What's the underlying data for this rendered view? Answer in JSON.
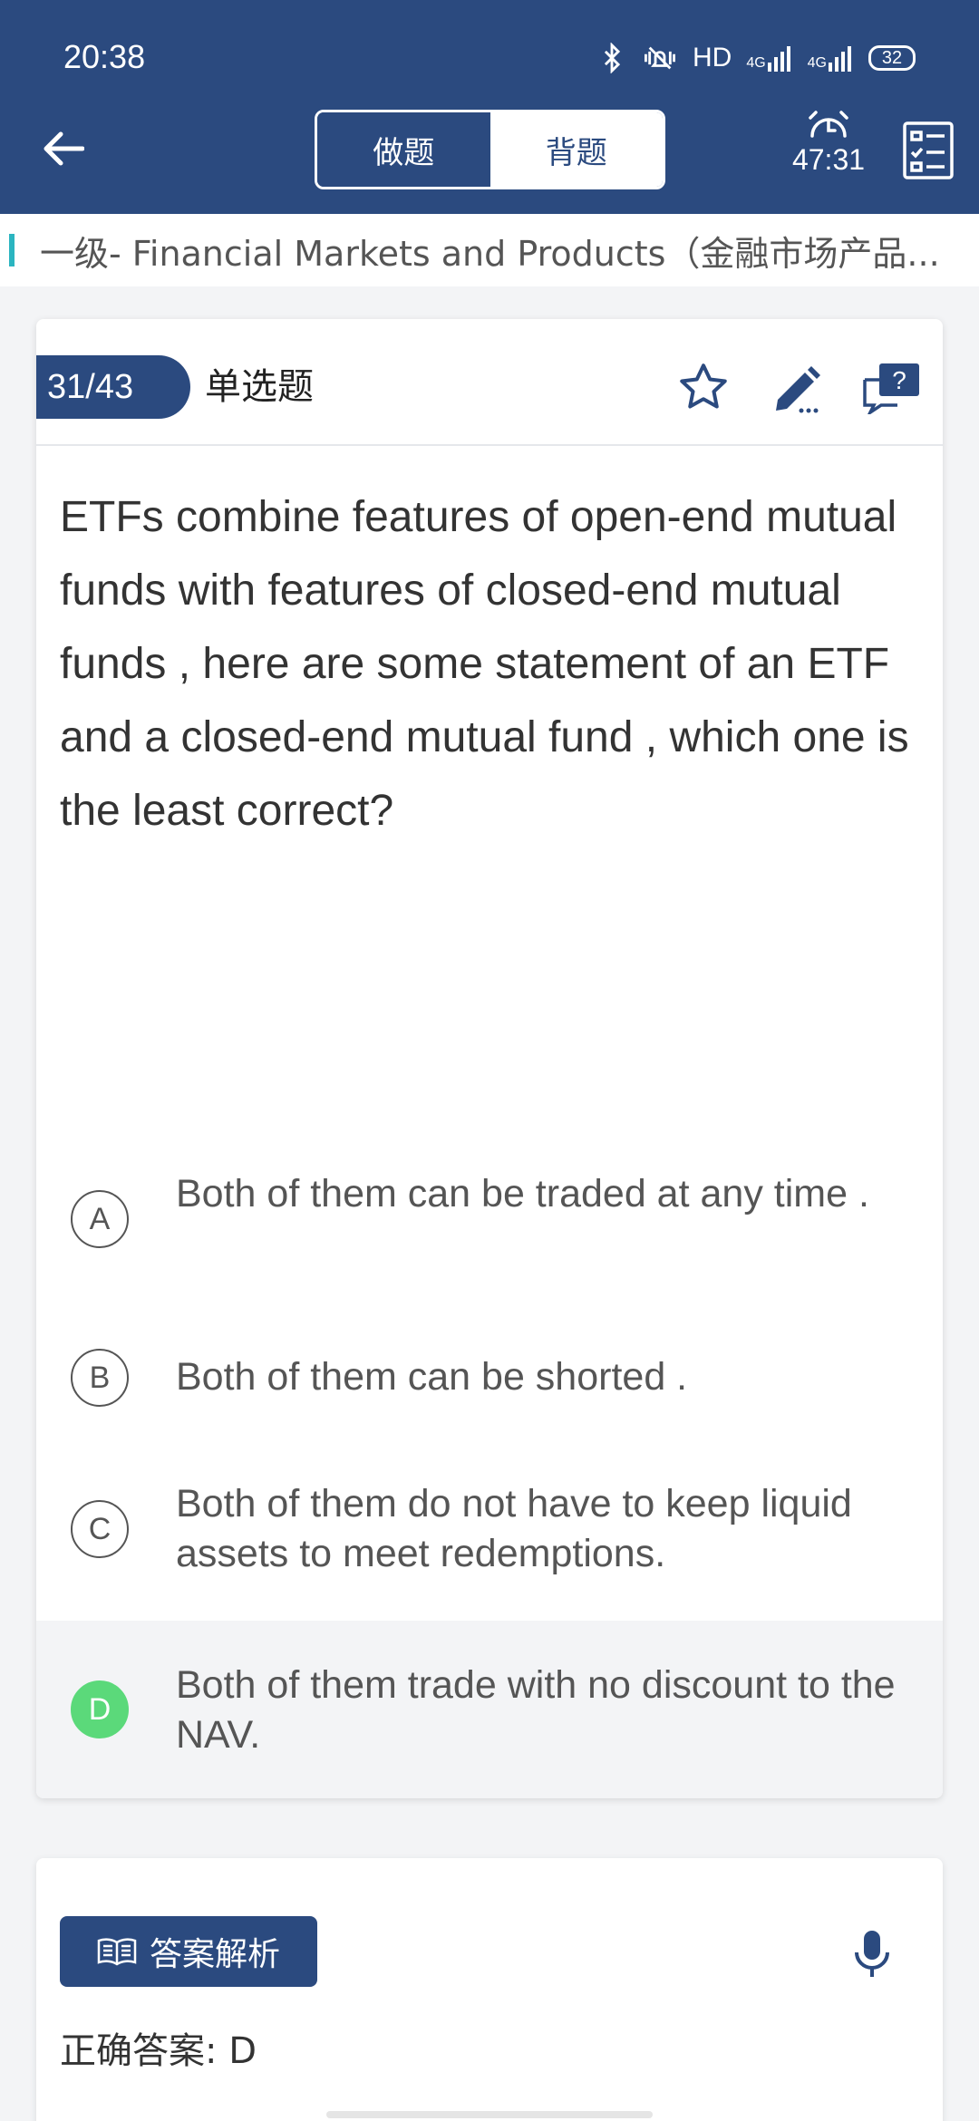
{
  "status_bar": {
    "time": "20:38",
    "network_label": "HD",
    "signal1": "4G",
    "signal2": "4G",
    "battery": "32"
  },
  "header": {
    "tabs": [
      {
        "label": "做题",
        "active": true
      },
      {
        "label": "背题",
        "active": false
      }
    ],
    "timer": "47:31"
  },
  "breadcrumb": {
    "text": "一级- Financial Markets and Products（金融市场产品..."
  },
  "question": {
    "progress": "31/43",
    "type": "单选题",
    "text": "ETFs combine features of open-end mutual funds with features of closed-end mutual funds , here are some statement of an ETF and a closed-end mutual fund , which one is the least correct?",
    "options": [
      {
        "letter": "A",
        "text": "Both of them can be traded at any time ."
      },
      {
        "letter": "B",
        "text": "Both of them can be shorted ."
      },
      {
        "letter": "C",
        "text": "Both of them do not have to keep liquid assets to meet redemptions."
      },
      {
        "letter": "D",
        "text": "Both of them trade with no discount to the NAV."
      }
    ],
    "selected": "D"
  },
  "analysis": {
    "button_label": "答案解析",
    "answer_text": "正确答案: D"
  },
  "colors": {
    "primary": "#2b4a7f",
    "accent": "#2bb5c0",
    "correct": "#5bd97a"
  }
}
